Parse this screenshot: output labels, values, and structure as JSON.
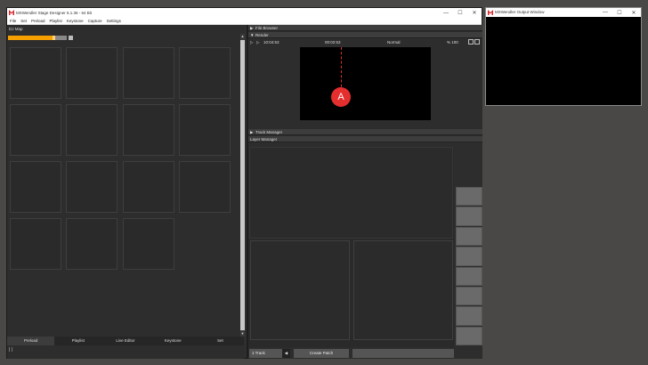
{
  "main_window": {
    "title": "MXWendler Stage Designer 6.1.36 - 64 Bit",
    "controls": [
      "—",
      "☐",
      "✕"
    ]
  },
  "menu": [
    "File",
    "Set",
    "Preload",
    "Playlist",
    "Keystone",
    "Capture",
    "Settings"
  ],
  "left": {
    "header": "DJ Map",
    "progress_fraction": 0.78,
    "tabs": [
      "Preload",
      "Playlist",
      "Live Editor",
      "Keystone",
      "Set"
    ],
    "active_tab": 0,
    "status": "| |"
  },
  "right": {
    "file_browser": "File Browser",
    "render": "Render",
    "play_icon_1": "▷",
    "play_icon_2": "▷",
    "time_left": "10:04:53",
    "time_center": "00:02:53",
    "blend_mode": "Normal",
    "zoom": "% 100",
    "marker_label": "A",
    "track_manager": "Track Manager",
    "layer_manager": "Layer Manager",
    "track_select": "1 Track",
    "create_patch": "Create Patch"
  },
  "output_window": {
    "title": "MXWendler Output Window",
    "controls": [
      "—",
      "☐",
      "✕"
    ]
  },
  "colors": {
    "accent": "#f5a000",
    "marker": "#e52e2e",
    "logo": "#d8232a"
  }
}
